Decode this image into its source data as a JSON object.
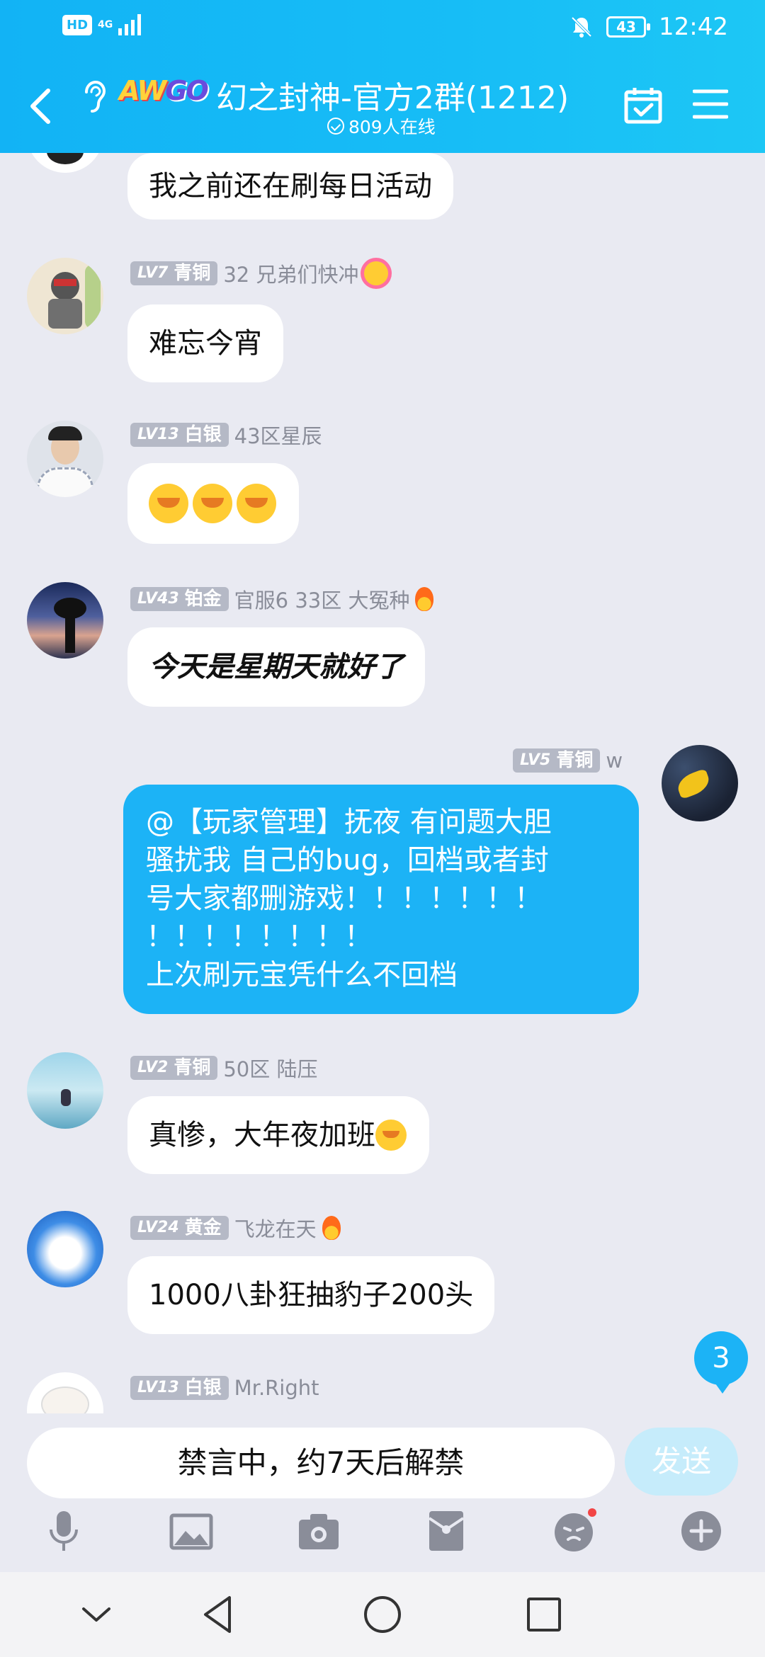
{
  "status_bar": {
    "hd": "HD",
    "network": "4G",
    "battery": "43",
    "time": "12:42"
  },
  "header": {
    "logo_a": "AW",
    "logo_b": "GO",
    "title": "幻之封神-官方2群(1212)",
    "online": "809人在线"
  },
  "messages": [
    {
      "text": "我之前还在刷每日活动"
    },
    {
      "level": "LV7",
      "rank": "青铜",
      "name": "32 兄弟们快冲",
      "text": "难忘今宵"
    },
    {
      "level": "LV13",
      "rank": "白银",
      "name": "43区星辰"
    },
    {
      "level": "LV43",
      "rank": "铂金",
      "name": "官服6  33区  大冤种",
      "text": "今天是星期天就好了"
    },
    {
      "level": "LV5",
      "rank": "青铜",
      "name": "w",
      "lines": [
        "@【玩家管理】抚夜 有问题大胆",
        "骚扰我 自己的bug，回档或者封",
        "号大家都删游戏！！！！！！！",
        "！！！！！！！！",
        "上次刷元宝凭什么不回档"
      ]
    },
    {
      "level": "LV2",
      "rank": "青铜",
      "name": "50区 陆压",
      "text": "真惨，大年夜加班"
    },
    {
      "level": "LV24",
      "rank": "黄金",
      "name": "飞龙在天",
      "text": "1000八卦狂抽豹子200头"
    },
    {
      "level": "LV13",
      "rank": "白银",
      "name": "Mr.Right"
    }
  ],
  "unread_count": "3",
  "input": {
    "muted_text": "禁言中，约7天后解禁",
    "send_label": "发送"
  },
  "colors": {
    "header": "#17bdf6",
    "bubble_self": "#1cb3f6",
    "badge": "#b5b9c6",
    "background": "#e9eaf2"
  }
}
